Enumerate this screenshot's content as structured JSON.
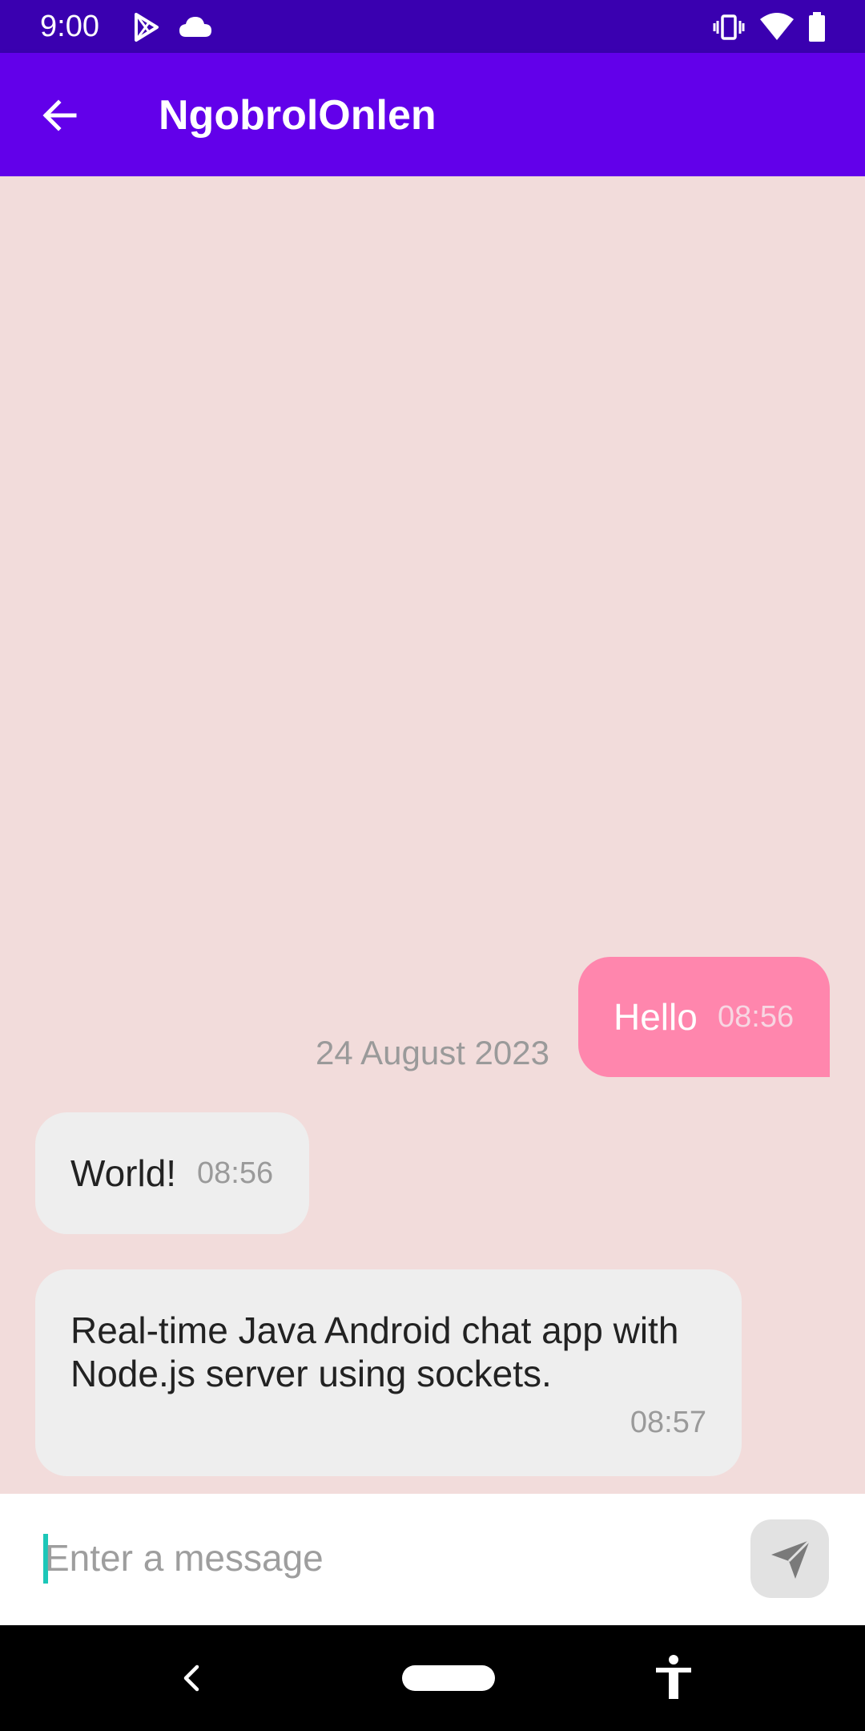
{
  "status_bar": {
    "time": "9:00",
    "icons_left": [
      "play-store-icon",
      "cloud-icon"
    ],
    "icons_right": [
      "vibrate-icon",
      "wifi-icon",
      "battery-icon"
    ]
  },
  "app_bar": {
    "title": "NgobrolOnlen",
    "back_icon": "arrow-back-icon"
  },
  "chat": {
    "date_separator": "24 August 2023",
    "messages": [
      {
        "direction": "outgoing",
        "text": "Hello",
        "time": "08:56"
      },
      {
        "direction": "incoming",
        "text": "World!",
        "time": "08:56"
      },
      {
        "direction": "incoming",
        "text_line1": "Real-time Java Android chat app with",
        "text_line2": "Node.js server using sockets.",
        "time": "08:57"
      }
    ]
  },
  "input_bar": {
    "placeholder": "Enter a message",
    "value": "",
    "send_icon": "send-icon"
  },
  "nav_bar": {
    "icons": [
      "nav-back-icon",
      "nav-home-pill",
      "accessibility-icon"
    ]
  },
  "colors": {
    "status_bar": "#3a00b0",
    "app_bar": "#6200ea",
    "chat_background": "#f2dcdb",
    "outgoing_bubble": "#ff86ad",
    "incoming_bubble": "#eeeeee",
    "cursor": "#1cc7b8"
  }
}
